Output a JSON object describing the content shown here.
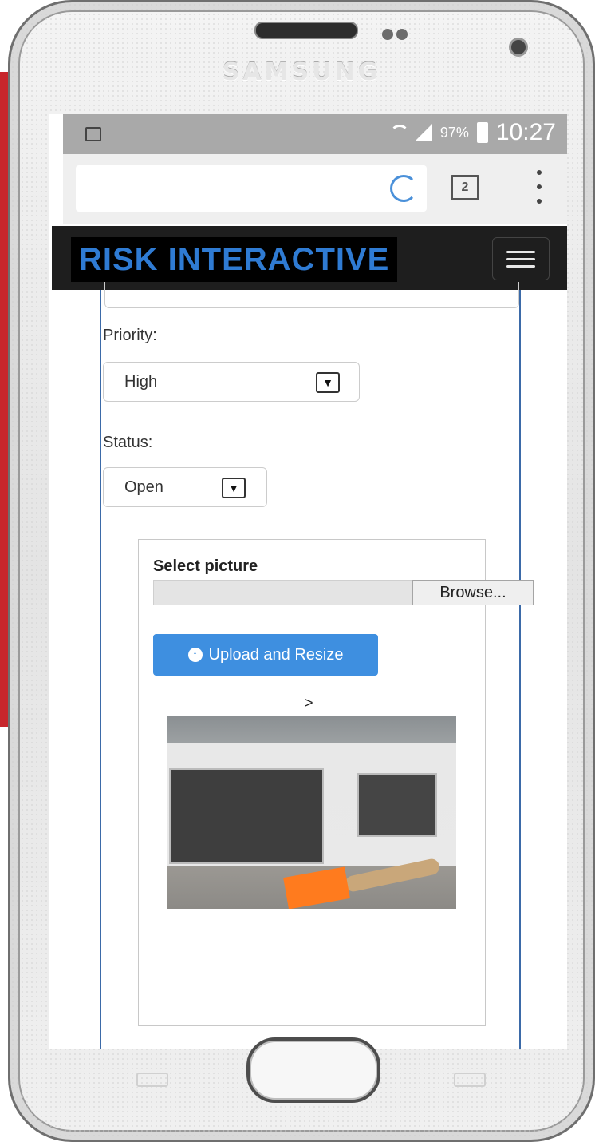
{
  "device": {
    "brand": "SAMSUNG"
  },
  "status_bar": {
    "battery": "97%",
    "time": "10:27"
  },
  "browser": {
    "tab_count": "2"
  },
  "app": {
    "logo_text": "RISK INTERACTIVE"
  },
  "form": {
    "priority": {
      "label": "Priority:",
      "value": "High"
    },
    "status": {
      "label": "Status:",
      "value": "Open"
    }
  },
  "upload": {
    "title": "Select picture",
    "browse_label": "Browse...",
    "button_label": "Upload and Resize",
    "preview_prefix": ">"
  },
  "colors": {
    "accent": "#3e8fe0",
    "navbar": "#1e1e1e",
    "logo": "#2f7bd3"
  }
}
